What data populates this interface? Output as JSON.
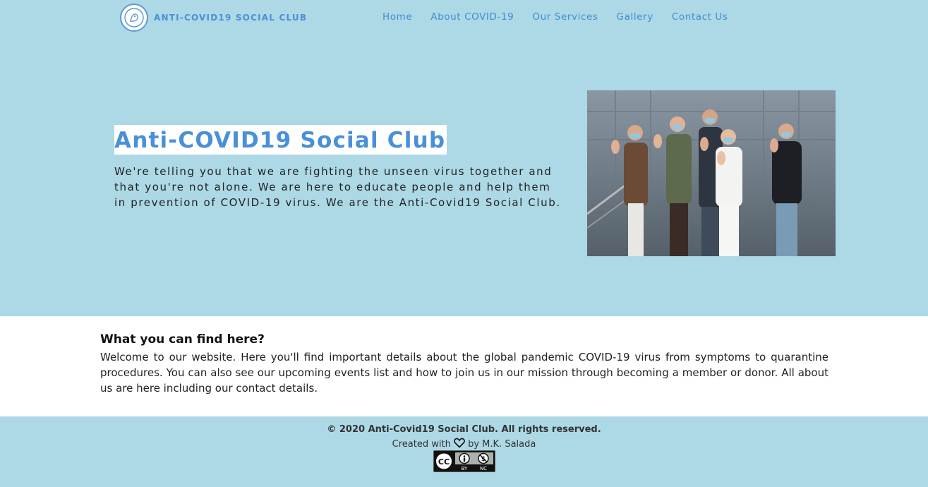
{
  "brand": {
    "name": "ANTI-COVID19 SOCIAL CLUB"
  },
  "nav": {
    "items": [
      "Home",
      "About COVID-19",
      "Our Services",
      "Gallery",
      "Contact Us"
    ]
  },
  "hero": {
    "title": "Anti-COVID19 Social Club",
    "text": "We're telling you that we are fighting the unseen virus together and that you're not alone. We are here to educate people and help them in prevention of COVID-19 virus. We are the Anti-Covid19 Social Club."
  },
  "info": {
    "title": "What you can find here?",
    "text": "Welcome to our website. Here you'll find important details about the global pandemic COVID-19 virus from symptoms to quarantine procedures. You can also see our upcoming events list and how to join us in our mission through becoming a member or donor. All about us are here including our contact details."
  },
  "footer": {
    "copyright": "© 2020 Anti-Covid19 Social Club. All rights reserved.",
    "credit_prefix": "Created with",
    "credit_suffix": "by M.K. Salada",
    "license": {
      "cc": "CC",
      "by": "BY",
      "nc": "NC"
    }
  },
  "colors": {
    "background": "#add8e6",
    "accent": "#4a90d9",
    "section": "#ffffff"
  },
  "icons": {
    "heart": "heart-icon",
    "logo": "club-logo"
  }
}
